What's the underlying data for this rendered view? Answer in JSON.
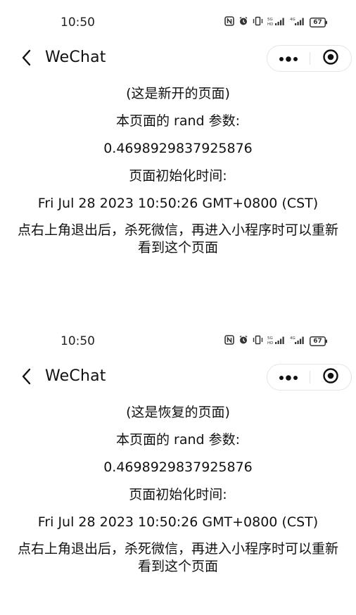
{
  "screens": [
    {
      "status_time": "10:50",
      "battery": "67",
      "nav_title": "WeChat",
      "header_text": "(这是新开的页面)",
      "rand_label": "本页面的 rand 参数:",
      "rand_value": "0.4698929837925876",
      "init_label": "页面初始化时间:",
      "init_time": "Fri Jul 28 2023 10:50:26 GMT+0800 (CST)",
      "notice": "点右上角退出后，杀死微信，再进入小程序时可以重新看到这个页面"
    },
    {
      "status_time": "10:50",
      "battery": "67",
      "nav_title": "WeChat",
      "header_text": "(这是恢复的页面)",
      "rand_label": "本页面的 rand 参数:",
      "rand_value": "0.4698929837925876",
      "init_label": "页面初始化时间:",
      "init_time": "Fri Jul 28 2023 10:50:26 GMT+0800 (CST)",
      "notice": "点右上角退出后，杀死微信，再进入小程序时可以重新看到这个页面"
    }
  ],
  "icons": {
    "back": "chevron-left-icon",
    "more": "more-dots-icon",
    "close": "target-circle-icon",
    "nfc": "nfc-icon",
    "alarm": "alarm-icon",
    "vibrate": "vibrate-icon",
    "signal": "signal-icon",
    "battery": "battery-icon"
  },
  "colors": {
    "background": "#ffffff",
    "text": "#111111",
    "capsule_border": "#e4e4e4"
  }
}
